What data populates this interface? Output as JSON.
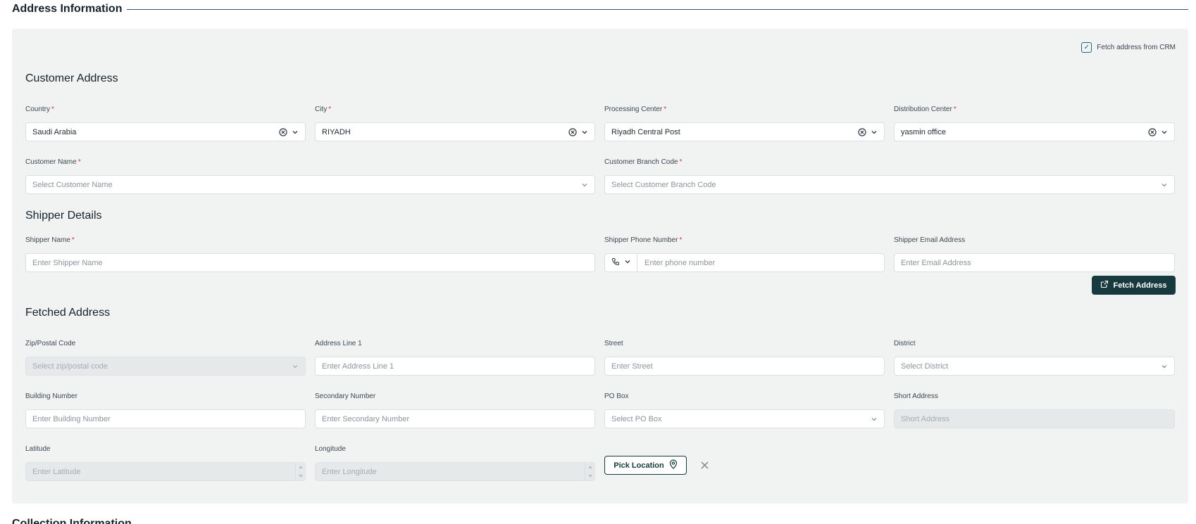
{
  "section_title": "Address Information",
  "fetch_crm_label": "Fetch address from CRM",
  "fetch_crm_checked": true,
  "customer_address": {
    "heading": "Customer Address",
    "country_label": "Country",
    "country_value": "Saudi Arabia",
    "city_label": "City",
    "city_value": "RIYADH",
    "processing_label": "Processing Center",
    "processing_value": "Riyadh Central Post",
    "distribution_label": "Distribution Center",
    "distribution_value": "yasmin office",
    "customer_name_label": "Customer Name",
    "customer_name_placeholder": "Select Customer Name",
    "branch_code_label": "Customer Branch Code",
    "branch_code_placeholder": "Select Customer Branch Code"
  },
  "shipper": {
    "heading": "Shipper Details",
    "name_label": "Shipper Name",
    "name_placeholder": "Enter Shipper Name",
    "phone_label": "Shipper Phone Number",
    "phone_placeholder": "Enter phone number",
    "email_label": "Shipper Email Address",
    "email_placeholder": "Enter Email Address"
  },
  "fetched": {
    "heading": "Fetched Address",
    "fetch_button": "Fetch Address",
    "zip_label": "Zip/Postal Code",
    "zip_placeholder": "Select zip/postal code",
    "line1_label": "Address Line 1",
    "line1_placeholder": "Enter Address Line 1",
    "street_label": "Street",
    "street_placeholder": "Enter Street",
    "district_label": "District",
    "district_placeholder": "Select District",
    "building_label": "Building Number",
    "building_placeholder": "Enter Building Number",
    "secondary_label": "Secondary Number",
    "secondary_placeholder": "Enter Secondary Number",
    "pobox_label": "PO Box",
    "pobox_placeholder": "Select PO Box",
    "short_label": "Short Address",
    "short_placeholder": "Short Address",
    "lat_label": "Latitude",
    "lat_placeholder": "Enter Latitude",
    "lng_label": "Longitude",
    "lng_placeholder": "Enter Longitude",
    "pick_button": "Pick Location"
  },
  "next_section_title": "Collection Information",
  "colors": {
    "primary": "#173a3f",
    "required": "#d6303a",
    "panel": "#f1f2f2",
    "rule": "#2b5876"
  }
}
